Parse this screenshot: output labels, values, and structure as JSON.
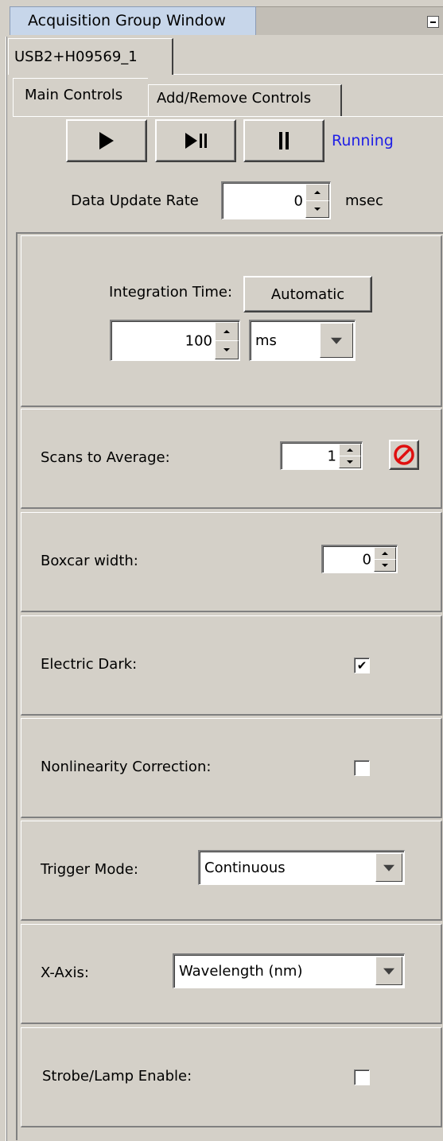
{
  "window": {
    "title": "Acquisition Group Window"
  },
  "device_tab": {
    "label": "USB2+H09569_1"
  },
  "tabs": [
    {
      "label": "Main Controls",
      "active": true
    },
    {
      "label": "Add/Remove Controls",
      "active": false
    }
  ],
  "toolbar": {
    "play_icon": "play-icon",
    "step_icon": "play-pause-icon",
    "pause_icon": "pause-icon",
    "status": "Running",
    "status_color": "#1f1fe6"
  },
  "update_rate": {
    "label": "Data Update Rate",
    "value": "0",
    "unit": "msec"
  },
  "integration": {
    "label": "Integration Time:",
    "auto_button": "Automatic",
    "value": "100",
    "unit": "ms"
  },
  "scans": {
    "label": "Scans to Average:",
    "value": "1",
    "icon": "no-entry-icon",
    "icon_color": "#e01010"
  },
  "boxcar": {
    "label": "Boxcar width:",
    "value": "0"
  },
  "electric_dark": {
    "label": "Electric Dark:",
    "checked": true,
    "check_mark": "✔"
  },
  "nonlinearity": {
    "label": "Nonlinearity Correction:",
    "checked": false
  },
  "trigger": {
    "label": "Trigger Mode:",
    "value": "Continuous"
  },
  "x_axis": {
    "label": "X-Axis:",
    "value": "Wavelength (nm)"
  },
  "strobe": {
    "label": "Strobe/Lamp Enable:",
    "checked": false
  }
}
